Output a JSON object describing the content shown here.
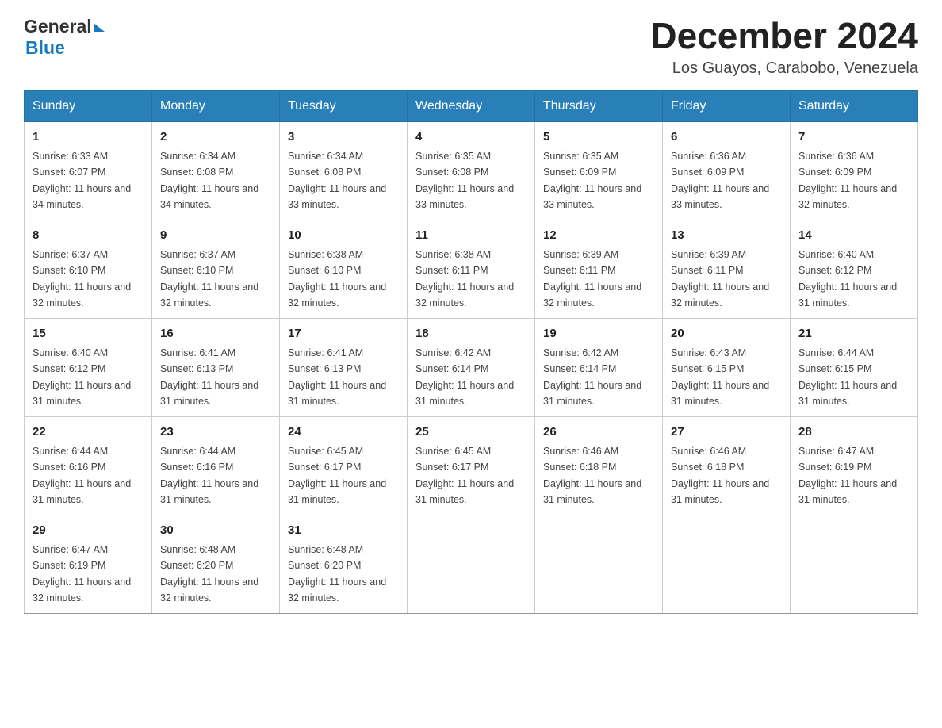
{
  "header": {
    "logo": {
      "general": "General",
      "blue": "Blue"
    },
    "title": "December 2024",
    "location": "Los Guayos, Carabobo, Venezuela"
  },
  "calendar": {
    "days_of_week": [
      "Sunday",
      "Monday",
      "Tuesday",
      "Wednesday",
      "Thursday",
      "Friday",
      "Saturday"
    ],
    "weeks": [
      [
        {
          "day": "1",
          "sunrise": "6:33 AM",
          "sunset": "6:07 PM",
          "daylight": "11 hours and 34 minutes."
        },
        {
          "day": "2",
          "sunrise": "6:34 AM",
          "sunset": "6:08 PM",
          "daylight": "11 hours and 34 minutes."
        },
        {
          "day": "3",
          "sunrise": "6:34 AM",
          "sunset": "6:08 PM",
          "daylight": "11 hours and 33 minutes."
        },
        {
          "day": "4",
          "sunrise": "6:35 AM",
          "sunset": "6:08 PM",
          "daylight": "11 hours and 33 minutes."
        },
        {
          "day": "5",
          "sunrise": "6:35 AM",
          "sunset": "6:09 PM",
          "daylight": "11 hours and 33 minutes."
        },
        {
          "day": "6",
          "sunrise": "6:36 AM",
          "sunset": "6:09 PM",
          "daylight": "11 hours and 33 minutes."
        },
        {
          "day": "7",
          "sunrise": "6:36 AM",
          "sunset": "6:09 PM",
          "daylight": "11 hours and 32 minutes."
        }
      ],
      [
        {
          "day": "8",
          "sunrise": "6:37 AM",
          "sunset": "6:10 PM",
          "daylight": "11 hours and 32 minutes."
        },
        {
          "day": "9",
          "sunrise": "6:37 AM",
          "sunset": "6:10 PM",
          "daylight": "11 hours and 32 minutes."
        },
        {
          "day": "10",
          "sunrise": "6:38 AM",
          "sunset": "6:10 PM",
          "daylight": "11 hours and 32 minutes."
        },
        {
          "day": "11",
          "sunrise": "6:38 AM",
          "sunset": "6:11 PM",
          "daylight": "11 hours and 32 minutes."
        },
        {
          "day": "12",
          "sunrise": "6:39 AM",
          "sunset": "6:11 PM",
          "daylight": "11 hours and 32 minutes."
        },
        {
          "day": "13",
          "sunrise": "6:39 AM",
          "sunset": "6:11 PM",
          "daylight": "11 hours and 32 minutes."
        },
        {
          "day": "14",
          "sunrise": "6:40 AM",
          "sunset": "6:12 PM",
          "daylight": "11 hours and 31 minutes."
        }
      ],
      [
        {
          "day": "15",
          "sunrise": "6:40 AM",
          "sunset": "6:12 PM",
          "daylight": "11 hours and 31 minutes."
        },
        {
          "day": "16",
          "sunrise": "6:41 AM",
          "sunset": "6:13 PM",
          "daylight": "11 hours and 31 minutes."
        },
        {
          "day": "17",
          "sunrise": "6:41 AM",
          "sunset": "6:13 PM",
          "daylight": "11 hours and 31 minutes."
        },
        {
          "day": "18",
          "sunrise": "6:42 AM",
          "sunset": "6:14 PM",
          "daylight": "11 hours and 31 minutes."
        },
        {
          "day": "19",
          "sunrise": "6:42 AM",
          "sunset": "6:14 PM",
          "daylight": "11 hours and 31 minutes."
        },
        {
          "day": "20",
          "sunrise": "6:43 AM",
          "sunset": "6:15 PM",
          "daylight": "11 hours and 31 minutes."
        },
        {
          "day": "21",
          "sunrise": "6:44 AM",
          "sunset": "6:15 PM",
          "daylight": "11 hours and 31 minutes."
        }
      ],
      [
        {
          "day": "22",
          "sunrise": "6:44 AM",
          "sunset": "6:16 PM",
          "daylight": "11 hours and 31 minutes."
        },
        {
          "day": "23",
          "sunrise": "6:44 AM",
          "sunset": "6:16 PM",
          "daylight": "11 hours and 31 minutes."
        },
        {
          "day": "24",
          "sunrise": "6:45 AM",
          "sunset": "6:17 PM",
          "daylight": "11 hours and 31 minutes."
        },
        {
          "day": "25",
          "sunrise": "6:45 AM",
          "sunset": "6:17 PM",
          "daylight": "11 hours and 31 minutes."
        },
        {
          "day": "26",
          "sunrise": "6:46 AM",
          "sunset": "6:18 PM",
          "daylight": "11 hours and 31 minutes."
        },
        {
          "day": "27",
          "sunrise": "6:46 AM",
          "sunset": "6:18 PM",
          "daylight": "11 hours and 31 minutes."
        },
        {
          "day": "28",
          "sunrise": "6:47 AM",
          "sunset": "6:19 PM",
          "daylight": "11 hours and 31 minutes."
        }
      ],
      [
        {
          "day": "29",
          "sunrise": "6:47 AM",
          "sunset": "6:19 PM",
          "daylight": "11 hours and 32 minutes."
        },
        {
          "day": "30",
          "sunrise": "6:48 AM",
          "sunset": "6:20 PM",
          "daylight": "11 hours and 32 minutes."
        },
        {
          "day": "31",
          "sunrise": "6:48 AM",
          "sunset": "6:20 PM",
          "daylight": "11 hours and 32 minutes."
        },
        null,
        null,
        null,
        null
      ]
    ],
    "labels": {
      "sunrise": "Sunrise:",
      "sunset": "Sunset:",
      "daylight": "Daylight:"
    }
  }
}
